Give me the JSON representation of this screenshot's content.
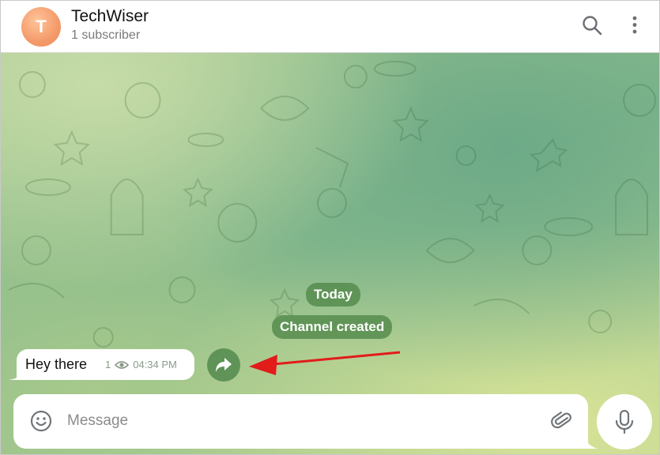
{
  "header": {
    "avatar_letter": "T",
    "title": "TechWiser",
    "subtitle": "1 subscriber",
    "search_icon": "search-icon",
    "more_icon": "more-vertical-icon"
  },
  "chat": {
    "service_messages": [
      {
        "text": "Today"
      },
      {
        "text": "Channel created"
      }
    ],
    "messages": [
      {
        "text": "Hey there",
        "views": "1",
        "time": "04:34 PM",
        "views_icon": "eye-icon"
      }
    ],
    "share_icon": "forward-share-icon",
    "annotation_arrow_color": "#e21b1b"
  },
  "composer": {
    "placeholder": "Message",
    "value": "",
    "emoji_icon": "emoji-icon",
    "attach_icon": "paperclip-icon",
    "mic_icon": "microphone-icon"
  },
  "colors": {
    "avatar": "#f49a6a",
    "pill_bg": "#568c4e",
    "accent_icon": "#707579"
  }
}
